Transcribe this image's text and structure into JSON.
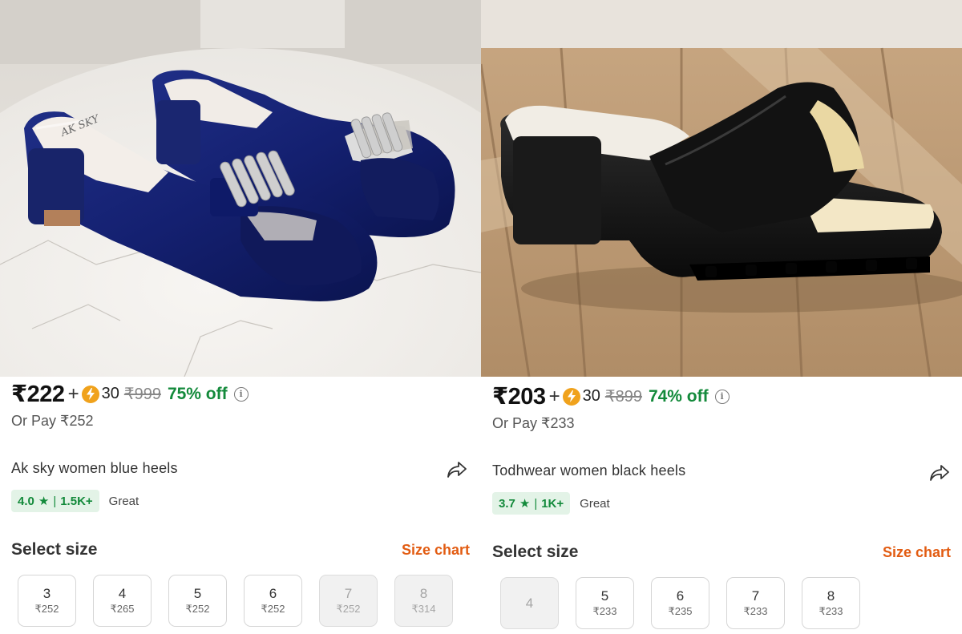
{
  "products": [
    {
      "price": "₹222",
      "plus": "+",
      "coins": "30",
      "mrp": "₹999",
      "discount": "75% off",
      "or_pay": "Or Pay ₹252",
      "title": "Ak sky women blue heels",
      "rating": "4.0",
      "reviews": "1.5K+",
      "rating_label": "Great",
      "select_size": "Select size",
      "size_chart": "Size chart",
      "image_brand_text": "AK SKY",
      "sizes": [
        {
          "size": "3",
          "price": "₹252",
          "available": true
        },
        {
          "size": "4",
          "price": "₹265",
          "available": true
        },
        {
          "size": "5",
          "price": "₹252",
          "available": true
        },
        {
          "size": "6",
          "price": "₹252",
          "available": true
        },
        {
          "size": "7",
          "price": "₹252",
          "available": false
        },
        {
          "size": "8",
          "price": "₹314",
          "available": false
        }
      ]
    },
    {
      "price": "₹203",
      "plus": "+",
      "coins": "30",
      "mrp": "₹899",
      "discount": "74% off",
      "or_pay": "Or Pay ₹233",
      "title": "Todhwear women black heels",
      "rating": "3.7",
      "reviews": "1K+",
      "rating_label": "Great",
      "select_size": "Select size",
      "size_chart": "Size chart",
      "sizes": [
        {
          "size": "4",
          "price": "",
          "available": false
        },
        {
          "size": "5",
          "price": "₹233",
          "available": true
        },
        {
          "size": "6",
          "price": "₹235",
          "available": true
        },
        {
          "size": "7",
          "price": "₹233",
          "available": true
        },
        {
          "size": "8",
          "price": "₹233",
          "available": true
        }
      ]
    }
  ],
  "colors": {
    "discount_green": "#138a3b",
    "rating_bg": "#e3f3e7",
    "size_chart_orange": "#e25c12",
    "coin_gold": "#f0a21c"
  },
  "icons": {
    "coin": "supercoin-bolt-icon",
    "info": "info-icon",
    "share": "share-arrow-icon",
    "star": "star-icon"
  }
}
